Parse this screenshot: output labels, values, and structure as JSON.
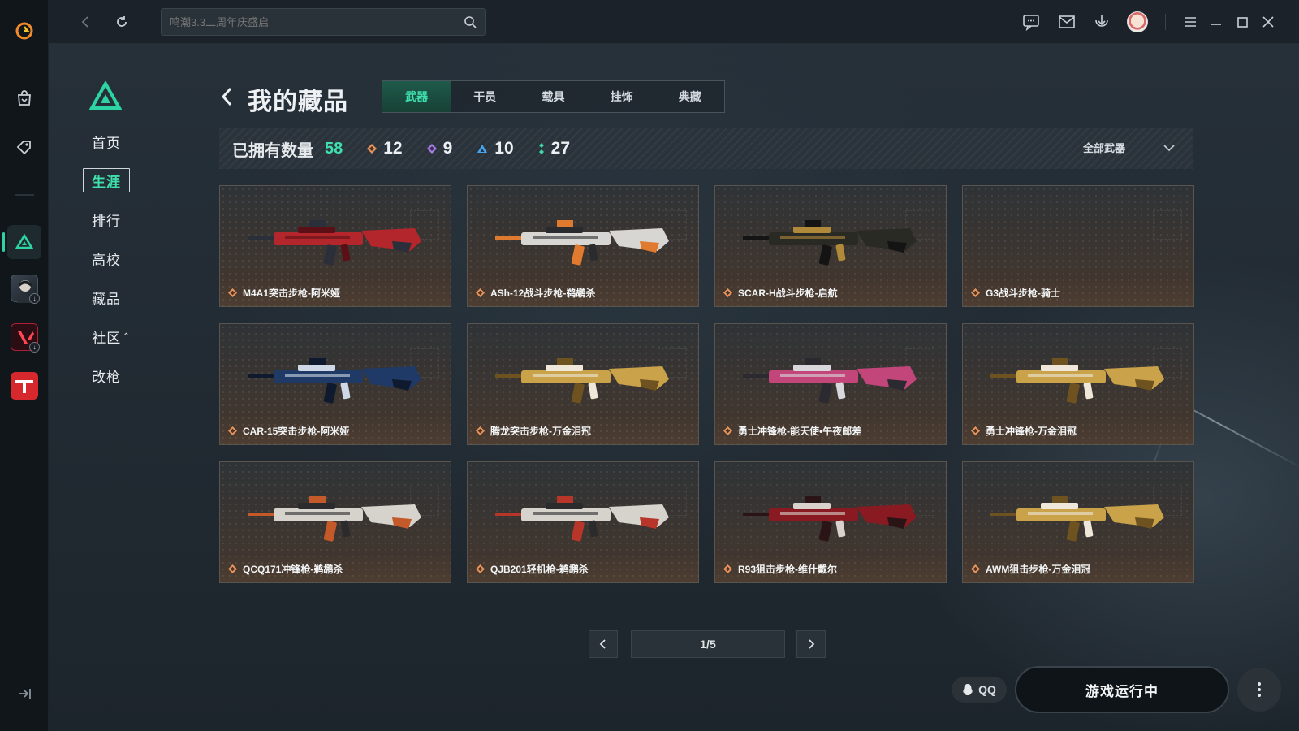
{
  "search": {
    "placeholder": "鸣潮3.3二周年庆盛启"
  },
  "subnav": {
    "items": [
      {
        "label": "首页"
      },
      {
        "label": "生涯"
      },
      {
        "label": "排行"
      },
      {
        "label": "高校"
      },
      {
        "label": "藏品"
      },
      {
        "label": "社区"
      },
      {
        "label": "改枪"
      }
    ],
    "active_index": 1
  },
  "page": {
    "title": "我的藏品"
  },
  "tabs": [
    {
      "label": "武器"
    },
    {
      "label": "干员"
    },
    {
      "label": "载具"
    },
    {
      "label": "挂饰"
    },
    {
      "label": "典藏"
    }
  ],
  "stats": {
    "owned_label": "已拥有数量",
    "owned_total": "58",
    "tiers": [
      {
        "value": "12",
        "color": "#e8935a"
      },
      {
        "value": "9",
        "color": "#a77de8"
      },
      {
        "value": "10",
        "color": "#4aa3e8"
      },
      {
        "value": "27",
        "color": "#3fd9a5"
      }
    ],
    "filter_label": "全部武器"
  },
  "cards": [
    {
      "name": "M4A1突击步枪-阿米娅",
      "rarity_color": "#e8935a",
      "palette": [
        "#b3262b",
        "#5a1014",
        "#2a2f3a"
      ]
    },
    {
      "name": "ASh-12战斗步枪-鹈鹕杀",
      "rarity_color": "#e8935a",
      "palette": [
        "#d8d6d2",
        "#2a2b2e",
        "#e07a2e"
      ]
    },
    {
      "name": "SCAR-H战斗步枪-启航",
      "rarity_color": "#e8935a",
      "palette": [
        "#2a2a24",
        "#b08a38",
        "#141414"
      ]
    },
    {
      "name": "G3战斗步枪-骑士",
      "rarity_color": "#e8935a",
      "palette": [
        "#444",
        "#444",
        "#444"
      ]
    },
    {
      "name": "CAR-15突击步枪-阿米娅",
      "rarity_color": "#e8935a",
      "palette": [
        "#1f3a66",
        "#cfd8e6",
        "#0f1a2e"
      ]
    },
    {
      "name": "腾龙突击步枪-万金泪冠",
      "rarity_color": "#e8935a",
      "palette": [
        "#c9a24a",
        "#efe8da",
        "#6e5220"
      ]
    },
    {
      "name": "勇士冲锋枪-能天使•午夜邮差",
      "rarity_color": "#e8935a",
      "palette": [
        "#c2467a",
        "#d8d8dc",
        "#2a2a30"
      ]
    },
    {
      "name": "勇士冲锋枪-万金泪冠",
      "rarity_color": "#e8935a",
      "palette": [
        "#c9a24a",
        "#efe8da",
        "#6e5220"
      ]
    },
    {
      "name": "QCQ171冲锋枪-鹈鹕杀",
      "rarity_color": "#e8935a",
      "palette": [
        "#d6d2cc",
        "#2b2b2d",
        "#c45a2a"
      ]
    },
    {
      "name": "QJB201轻机枪-鹈鹕杀",
      "rarity_color": "#e8935a",
      "palette": [
        "#d6d2cc",
        "#2b2b2d",
        "#b8352a"
      ]
    },
    {
      "name": "R93狙击步枪-维什戴尔",
      "rarity_color": "#e8935a",
      "palette": [
        "#8a1a22",
        "#d9d2cc",
        "#2a1416"
      ]
    },
    {
      "name": "AWM狙击步枪-万金泪冠",
      "rarity_color": "#e8935a",
      "palette": [
        "#c9a24a",
        "#efe8da",
        "#6e5220"
      ]
    }
  ],
  "pagination": {
    "current_label": "1/5"
  },
  "bottom": {
    "qq_label": "QQ",
    "launch_label": "游戏运行中"
  },
  "colors": {
    "accent": "#3fe0ae"
  }
}
